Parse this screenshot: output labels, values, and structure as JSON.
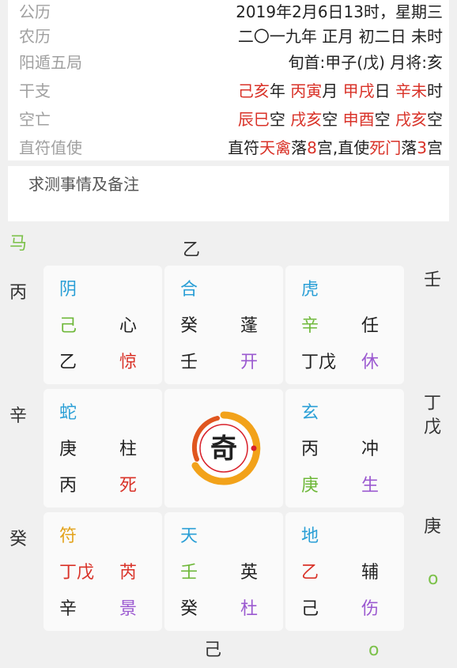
{
  "info": {
    "rows": [
      {
        "label": "公历",
        "value": "2019年2月6日13时，星期三"
      },
      {
        "label": "农历",
        "value": "二〇一九年 正月 初二日 未时"
      },
      {
        "label": "阳遁五局",
        "value": "旬首:甲子(戊) 月将:亥"
      },
      {
        "label": "干支",
        "segments": [
          "己亥",
          "年 ",
          "丙寅",
          "月 ",
          "甲戌",
          "日 ",
          "辛未",
          "时"
        ]
      },
      {
        "label": "空亡",
        "segments": [
          "辰巳",
          "空 ",
          "戌亥",
          "空 ",
          "申酉",
          "空 ",
          "戌亥",
          "空"
        ]
      },
      {
        "label": "直符值使",
        "segments": [
          "直符",
          "天禽",
          "落",
          "8",
          "宫,直使",
          "死门",
          "落",
          "3",
          "宫"
        ]
      }
    ]
  },
  "notes": {
    "placeholder": "求测事情及备注"
  },
  "outer": {
    "ma": "马",
    "top": "乙",
    "left_top": "丙",
    "left_mid": "辛",
    "left_bottom": "癸",
    "right_top": "壬",
    "right_mid": "丁\n戊",
    "right_bottom": "庚",
    "right_circle": "o",
    "bottom": "己",
    "bottom_circle": "o"
  },
  "palaces": [
    {
      "god": "阴",
      "heaven_stem": "己",
      "star": "心",
      "earth_stem": "乙",
      "door": "惊"
    },
    {
      "god": "合",
      "heaven_stem": "癸",
      "star": "蓬",
      "earth_stem": "壬",
      "door": "开"
    },
    {
      "god": "虎",
      "heaven_stem": "辛",
      "star": "任",
      "earth_stem": "丁戊",
      "door": "休"
    },
    {
      "god": "蛇",
      "heaven_stem": "庚",
      "star": "柱",
      "earth_stem": "丙",
      "door": "死"
    },
    {
      "logo": "奇"
    },
    {
      "god": "玄",
      "heaven_stem": "丙",
      "star": "冲",
      "earth_stem": "庚",
      "door": "生"
    },
    {
      "god": "符",
      "heaven_stem": "丁戊",
      "star": "芮",
      "earth_stem": "辛",
      "door": "景"
    },
    {
      "god": "天",
      "heaven_stem": "壬",
      "star": "英",
      "earth_stem": "癸",
      "door": "杜"
    },
    {
      "god": "地",
      "heaven_stem": "乙",
      "star": "辅",
      "earth_stem": "己",
      "door": "伤"
    }
  ],
  "colors": {
    "red": "#d93228",
    "blue": "#2a9fd6",
    "green": "#6fb83a",
    "purple": "#9b59d0",
    "gold": "#e3a21a",
    "label_gray": "#a0a0a0"
  }
}
